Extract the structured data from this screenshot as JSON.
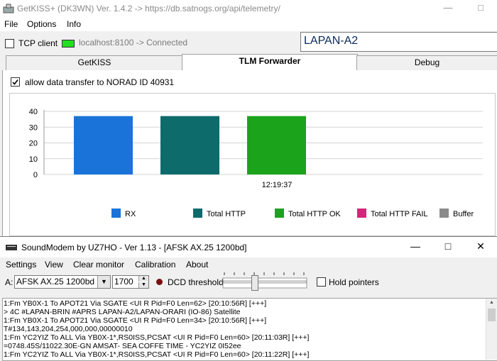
{
  "getkiss": {
    "title": "GetKISS+ (DK3WN) Ver. 1.4.2 -> https://db.satnogs.org/api/telemetry/",
    "menu": [
      "File",
      "Options",
      "Info"
    ],
    "tcp_client_label": "TCP client",
    "connection_status": "localhost:8100 -> Connected",
    "satellite_name": "LAPAN-A2",
    "tabs": [
      {
        "label": "GetKISS",
        "active": false
      },
      {
        "label": "TLM Forwarder",
        "active": true
      },
      {
        "label": "Debug",
        "active": false
      }
    ],
    "norad_checkbox_label": "allow data transfer to NORAD ID 40931",
    "status_color": "#20e020"
  },
  "chart_data": {
    "type": "bar",
    "categories": [
      "12:19:37"
    ],
    "series": [
      {
        "name": "RX",
        "values": [
          37
        ],
        "color": "#1a73d9"
      },
      {
        "name": "Total HTTP",
        "values": [
          37
        ],
        "color": "#0d6b6b"
      },
      {
        "name": "Total HTTP OK",
        "values": [
          37
        ],
        "color": "#1ca31c"
      },
      {
        "name": "Total HTTP FAIL",
        "values": [
          0
        ],
        "color": "#d6247a"
      },
      {
        "name": "Buffer",
        "values": [
          0
        ],
        "color": "#8a8a8a"
      }
    ],
    "yticks": [
      "40",
      "30",
      "20",
      "10",
      "0"
    ],
    "ylim": [
      0,
      40
    ],
    "grid": true,
    "legend": "bottom"
  },
  "soundmodem": {
    "title": "SoundModem by UZ7HO - Ver 1.13 - [AFSK AX.25 1200bd]",
    "menu": [
      "Settings",
      "View",
      "Clear monitor",
      "Calibration",
      "About"
    ],
    "channel_label": "A:",
    "mode_value": "AFSK AX.25 1200bd",
    "freq_value": "1700",
    "dcd_label": "DCD threshold",
    "hold_label": "Hold pointers",
    "log_lines": [
      "1:Fm YB0X-1 To APOT21 Via SGATE <UI R Pid=F0 Len=62> [20:10:56R] [+++]",
      ">  4C #LAPAN-BRIN #APRS LAPAN-A2/LAPAN-ORARI (IO-86) Satellite",
      "1:Fm YB0X-1 To APOT21 Via SGATE <UI R Pid=F0 Len=34> [20:10:56R] [+++]",
      "T#134,143,204,254,000,000,00000010",
      "1:Fm YC2YIZ To ALL Via YB0X-1*,RS0ISS,PCSAT <UI R Pid=F0 Len=60> [20:11:03R] [+++]",
      "=0748.45S/11022.30E-GN AMSAT- SEA COFFE TIME - YC2YIZ 0I52ee",
      "1:Fm YC2YIZ To ALL Via YB0X-1*,RS0ISS,PCSAT <UI R Pid=F0 Len=60> [20:11:22R] [+++]"
    ]
  }
}
